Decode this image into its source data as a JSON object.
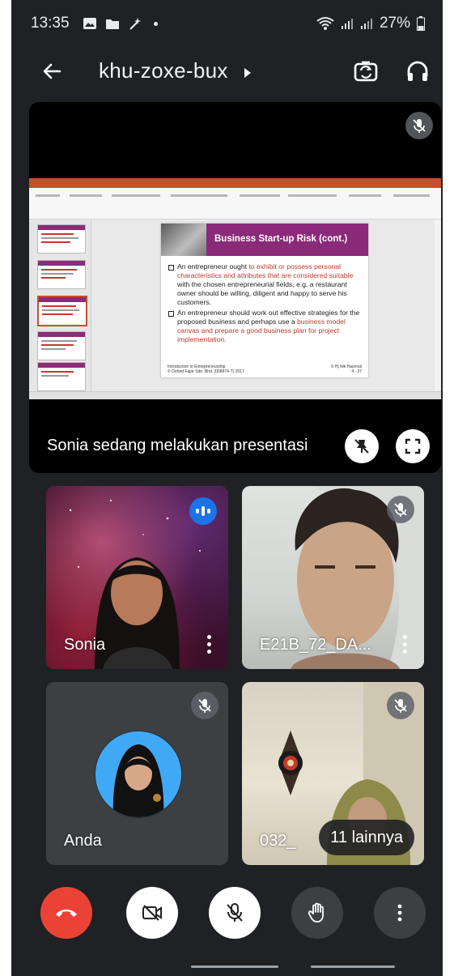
{
  "status_bar": {
    "time": "13:35",
    "battery": "27%",
    "icons": [
      "gallery-icon",
      "folder-icon",
      "magic-icon",
      "dot-icon",
      "wifi-icon",
      "signal-icon",
      "signal-icon",
      "battery-icon"
    ]
  },
  "header": {
    "meeting_code": "khu-zoxe-bux",
    "icons": [
      "back-arrow-icon",
      "switch-camera-icon",
      "audio-output-icon"
    ]
  },
  "presentation": {
    "caption": "Sonia sedang melakukan presentasi",
    "slide": {
      "title": "Business Start-up Risk (cont.)",
      "bullet1_a": "An entrepreneur ought ",
      "bullet1_b": "to exhibit or possess personal characteristics and attributes that are considered suitable",
      "bullet1_c": " with the chosen entrepreneurial fields, e.g. a restaurant owner should be willing, diligent and happy to serve his customers.",
      "bullet2_a": "An entrepreneur should work out effective strategies for the proposed business and perhaps use a ",
      "bullet2_b": "business model canvas and prepare a good business plan for project implementation.",
      "footer_left": "Introduction to Entrepreneurship",
      "footer_left2": "© Oxford Fajar Sdn. Bhd. (008974-T) 2017",
      "footer_right": "© Hj Nik Hasnnal",
      "footer_page": "4 - 37"
    }
  },
  "participants": [
    {
      "name": "Sonia",
      "state": "speaking"
    },
    {
      "name": "E21B_72_DA...",
      "state": "muted"
    },
    {
      "name": "Anda",
      "state": "muted"
    },
    {
      "name": "032_",
      "state": "muted"
    }
  ],
  "others_label": "11 lainnya",
  "controls": [
    "end-call",
    "camera-off",
    "mic-off",
    "raise-hand",
    "more-options"
  ],
  "colors": {
    "background": "#202124",
    "end_call": "#ea4335",
    "speaking": "#1a73e8",
    "slide_accent": "#8c2a7a"
  }
}
